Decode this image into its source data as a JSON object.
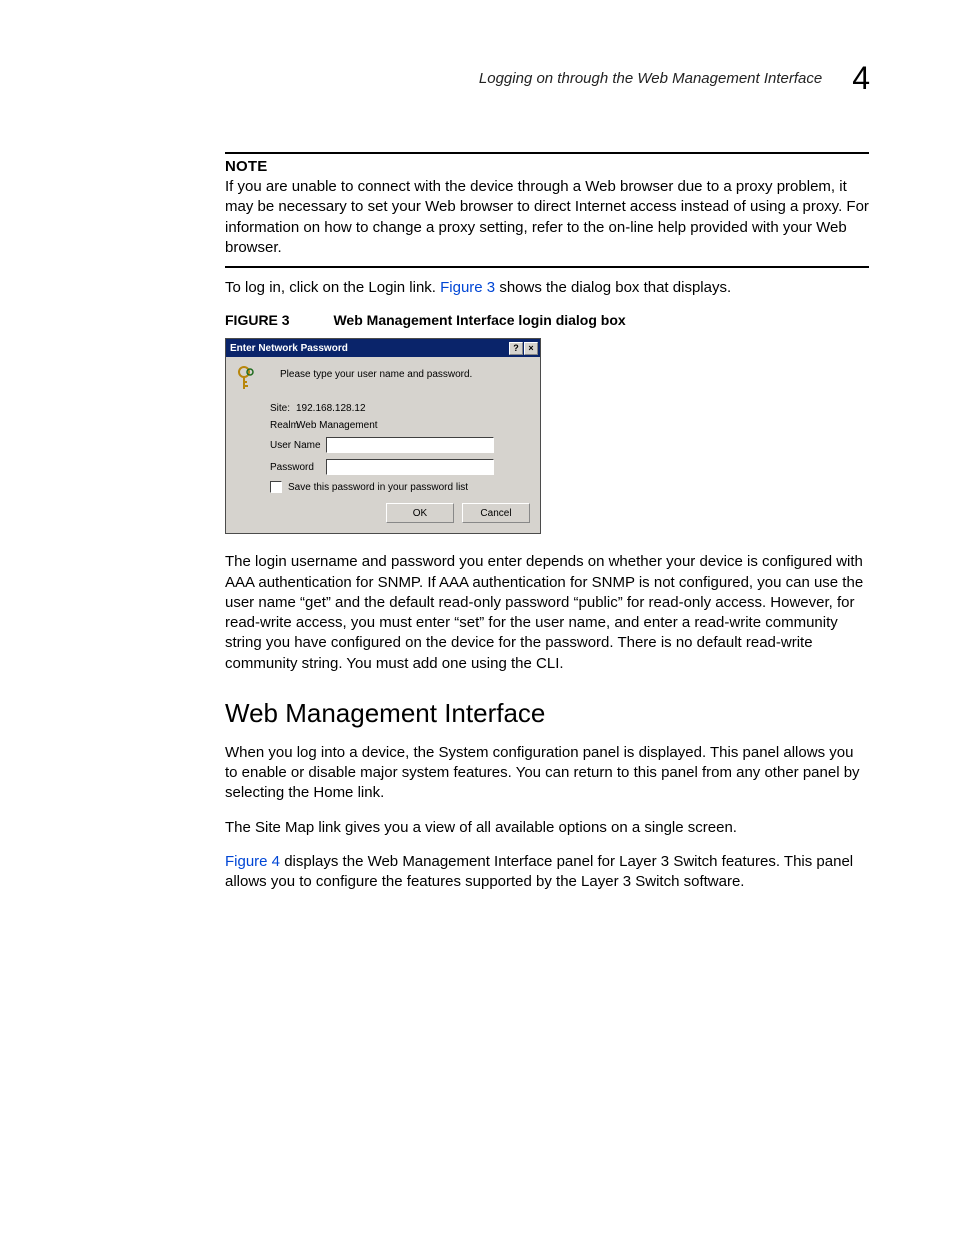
{
  "header": {
    "running_title": "Logging on through the Web Management Interface",
    "chapter_number": "4"
  },
  "note": {
    "label": "NOTE",
    "text": "If you are unable to connect with the device through a Web browser due to a proxy problem, it may be necessary to set your Web browser to direct Internet access instead of using a proxy. For information on how to change a proxy setting, refer to the on-line help provided with your Web browser."
  },
  "para_login_intro_pre": "To log in, click on the Login link. ",
  "figure3_link": "Figure 3",
  "para_login_intro_post": " shows the dialog box that displays.",
  "figure3": {
    "label": "FIGURE 3",
    "title": "Web Management Interface login dialog box"
  },
  "dialog": {
    "title": "Enter Network Password",
    "help_glyph": "?",
    "close_glyph": "×",
    "instruction": "Please type your user name and password.",
    "site_label": "Site:",
    "site_value": "192.168.128.12",
    "realm_label": "Realm",
    "realm_value": "Web Management",
    "username_label": "User Name",
    "username_value": "",
    "password_label": "Password",
    "password_value": "",
    "save_checkbox_label": "Save this password in your password list",
    "ok_label": "OK",
    "cancel_label": "Cancel"
  },
  "para_auth": "The login username and password you enter depends on whether your device is configured with AAA authentication for SNMP. If AAA authentication for SNMP is not configured, you can use the user name “get” and the default read-only password “public” for read-only access. However, for read-write access, you must enter “set” for the user name, and enter a read-write community string you have configured on the device for the password. There is no default read-write community string. You must add one using the CLI.",
  "section_heading": "Web Management Interface",
  "para_wmi1": "When you log into a device, the System configuration panel is displayed. This panel allows you to enable or disable major system features. You can return to this panel from any other panel by selecting the Home link.",
  "para_wmi2": "The Site Map link gives you a view of all available options on a single screen.",
  "figure4_link": "Figure 4",
  "para_wmi3_post": " displays the Web Management Interface panel for Layer 3 Switch features. This panel allows you to configure the features supported by the Layer 3 Switch software."
}
